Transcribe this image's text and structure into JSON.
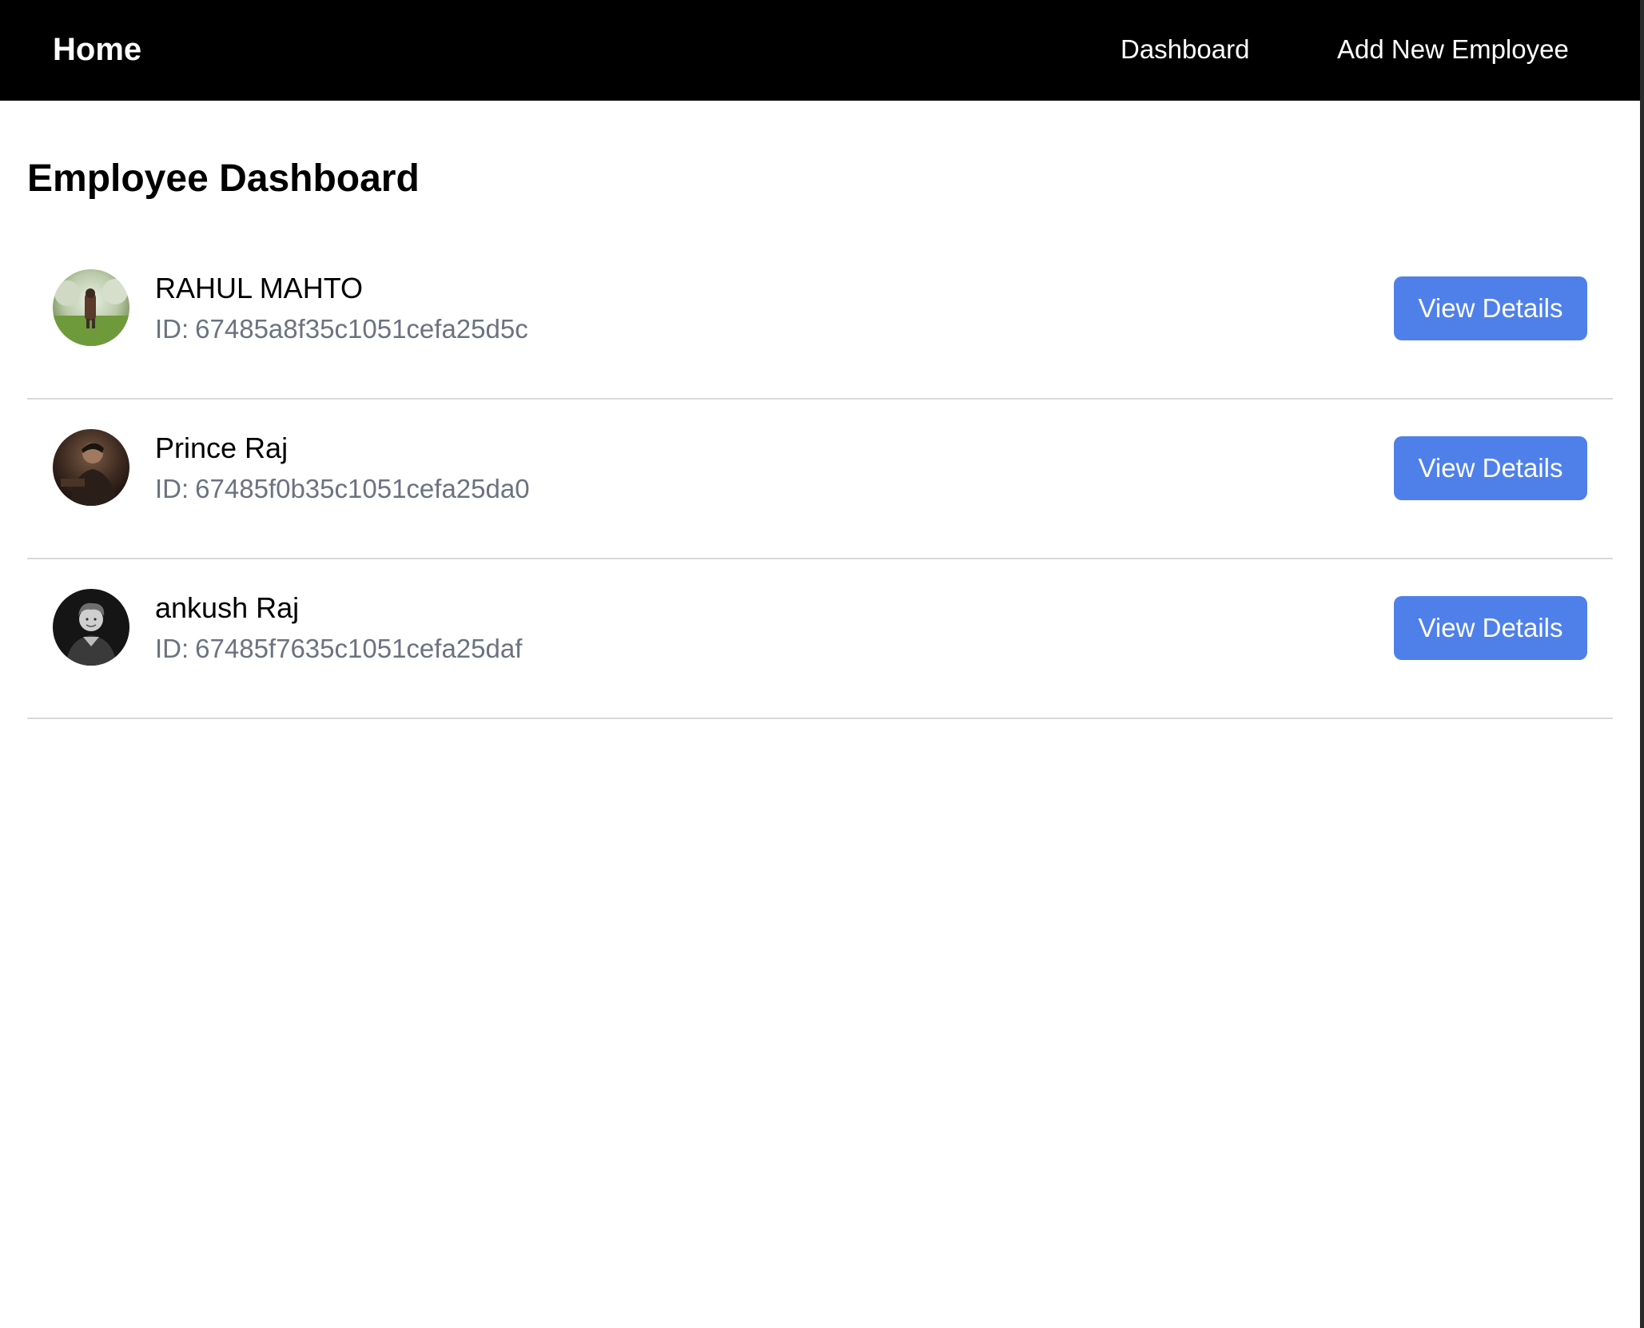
{
  "navbar": {
    "home_label": "Home",
    "links": [
      {
        "label": "Dashboard"
      },
      {
        "label": "Add New Employee"
      }
    ]
  },
  "page": {
    "title": "Employee Dashboard"
  },
  "employees": [
    {
      "name": "RAHUL MAHTO",
      "id_prefix": "ID:",
      "id": "67485a8f35c1051cefa25d5c",
      "button_label": "View Details",
      "avatar": "photo-outdoor-trees"
    },
    {
      "name": "Prince Raj",
      "id_prefix": "ID:",
      "id": "67485f0b35c1051cefa25da0",
      "button_label": "View Details",
      "avatar": "photo-dark-portrait"
    },
    {
      "name": "ankush Raj",
      "id_prefix": "ID:",
      "id": "67485f7635c1051cefa25daf",
      "button_label": "View Details",
      "avatar": "photo-bw-portrait"
    }
  ],
  "colors": {
    "navbar_bg": "#000000",
    "button_bg": "#4f80ea",
    "id_text": "#6b7280",
    "divider": "#d9d9d9"
  }
}
